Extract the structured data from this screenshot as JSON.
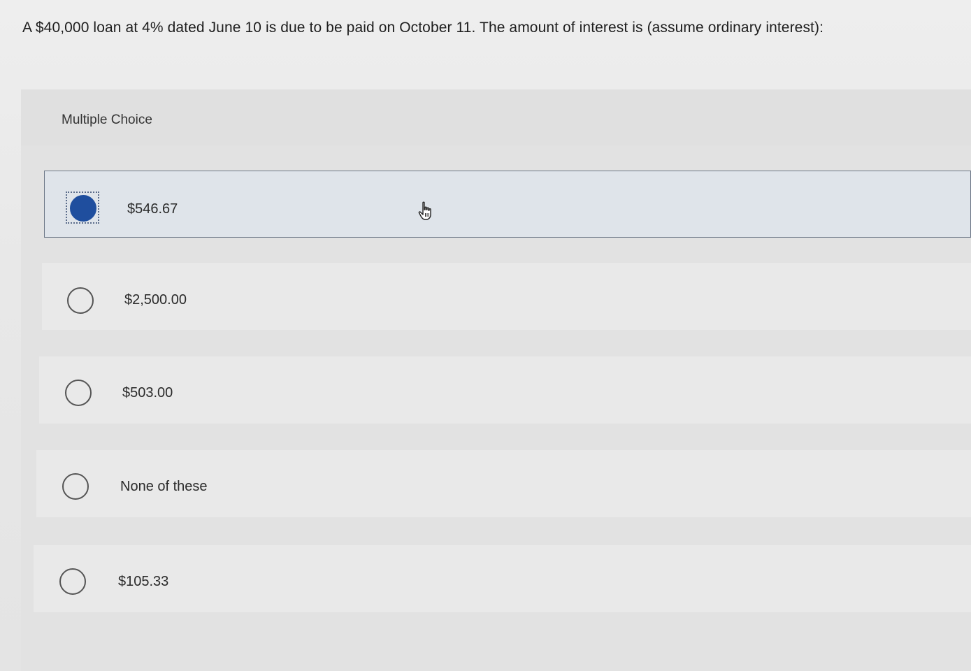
{
  "question": {
    "text": "A $40,000 loan at 4% dated June 10 is due to be paid on October 11. The amount of interest is (assume ordinary interest):"
  },
  "multiple_choice": {
    "label": "Multiple Choice",
    "options": [
      {
        "label": "$546.67",
        "selected": true
      },
      {
        "label": "$2,500.00",
        "selected": false
      },
      {
        "label": "$503.00",
        "selected": false
      },
      {
        "label": "None of these",
        "selected": false
      },
      {
        "label": "$105.33",
        "selected": false
      }
    ]
  },
  "colors": {
    "selected_radio": "#1f4e9e",
    "selected_row_background": "#dfe4ea",
    "row_background": "#e9e9e9"
  },
  "icons": {
    "cursor": "hand-pointer-icon"
  }
}
